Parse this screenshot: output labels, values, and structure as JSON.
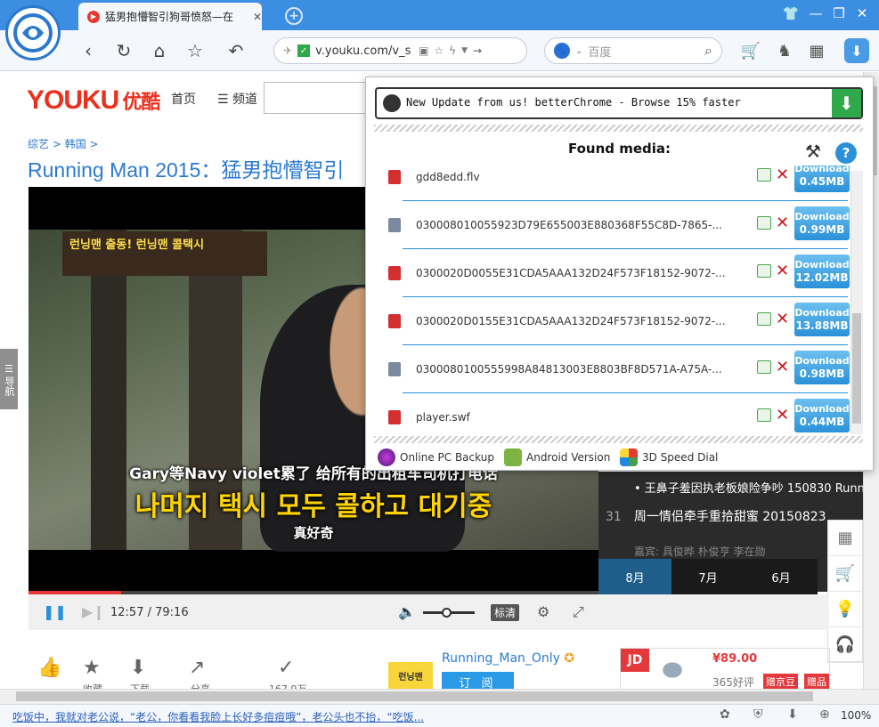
{
  "browser": {
    "tab_title": "猛男抱懵智引狗哥愤怒—在",
    "address_url": "v.youku.com/v_s",
    "search_engine_placeholder": "百度",
    "zoom": "100%",
    "status_link": "吃饭中，我就对老公说，“老公，你看看我脸上长好多痘痘哦”，老公头也不抬，“吃饭..."
  },
  "site": {
    "logo_text": "YOUKU",
    "logo_cn": "优酷",
    "nav_home": "首页",
    "nav_channel": "频道",
    "breadcrumb_1": "综艺",
    "breadcrumb_2": "韩国",
    "video_title": "Running Man 2015：猛男抱懵智引",
    "side_tab": "导航"
  },
  "player": {
    "time_current": "12:57",
    "time_total": "79:16",
    "quality": "标清",
    "progress_fraction": 0.163,
    "volume_fraction": 0.5,
    "sign_text": "런닝맨  출동! 런닝맨 콜택시",
    "sub_cn_1": "Gary等Navy violet累了 给所有的出租车司机打电话",
    "sub_kr": "나머지 택시 모두 콜하고 대기중",
    "sub_cn_2": "真好奇"
  },
  "playlist": {
    "row1": "•  王鼻子羞因执老板娘险争吵 150830 Running",
    "row2_num": "31",
    "row2_title": "周一情侣牵手重拾甜蜜 20150823",
    "row3_guests": "嘉宾: 具俊晔  朴俊亨  李在勋",
    "months": [
      "8月",
      "7月",
      "6月"
    ]
  },
  "actions": {
    "like_label": "",
    "fav_label": "收藏",
    "download_label": "下载",
    "share_label": "分享",
    "views_label": "167.9万"
  },
  "channel": {
    "name": "Running_Man_Only",
    "subscribe": "订 阅",
    "logo_text": "런닝맨"
  },
  "ad": {
    "brand": "JD",
    "price": "¥89.00",
    "reviews": "365好评",
    "tag1": "赠京豆",
    "tag2": "赠品"
  },
  "popup": {
    "update_text": "New Update from us! betterChrome - Browse 15% faster",
    "found_title": "Found media:",
    "download_label": "Download",
    "media": [
      {
        "name": "gdd8edd.flv",
        "size": "0.45MB",
        "type": "flv"
      },
      {
        "name": "030008010055923D79E655003E880368F55C8D-7865-...",
        "size": "0.99MB",
        "type": "img"
      },
      {
        "name": "0300020D0055E31CDA5AAA132D24F573F18152-9072-...",
        "size": "12.02MB",
        "type": "flv"
      },
      {
        "name": "0300020D0155E31CDA5AAA132D24F573F18152-9072-...",
        "size": "13.88MB",
        "type": "flv"
      },
      {
        "name": "0300080100555998A84813003E8803BF8D571A-A75A-...",
        "size": "0.98MB",
        "type": "img"
      },
      {
        "name": "player.swf",
        "size": "0.44MB",
        "type": "swf"
      }
    ],
    "footer_backup": "Online PC Backup",
    "footer_android": "Android Version",
    "footer_speeddial": "3D Speed Dial"
  },
  "colors": {
    "browser_blue": "#3c8ee3",
    "youku_red": "#e8321e",
    "link_blue": "#2a7ad1",
    "download_green": "#2ea84a"
  }
}
